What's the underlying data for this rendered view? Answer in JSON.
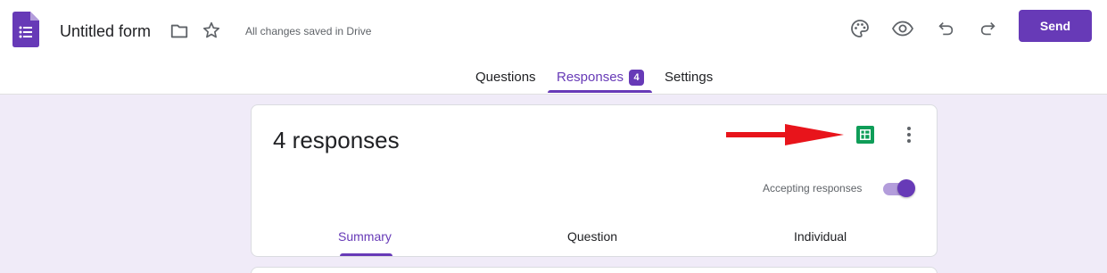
{
  "header": {
    "form_title": "Untitled form",
    "save_status": "All changes saved in Drive",
    "send_label": "Send"
  },
  "tabs": [
    {
      "label": "Questions"
    },
    {
      "label": "Responses",
      "badge": "4",
      "active": true
    },
    {
      "label": "Settings"
    }
  ],
  "responses_card": {
    "count_text": "4 responses",
    "accepting_label": "Accepting responses",
    "accepting_enabled": true,
    "subtabs": [
      {
        "label": "Summary",
        "active": true
      },
      {
        "label": "Question"
      },
      {
        "label": "Individual"
      }
    ]
  },
  "icons": {
    "logo": "google-forms-icon",
    "folder": "folder-icon",
    "star": "star-icon",
    "palette": "palette-icon",
    "preview": "eye-icon",
    "undo": "undo-icon",
    "redo": "redo-icon",
    "sheets": "sheets-icon",
    "more": "more-vert-icon",
    "annotation": "red-arrow"
  },
  "colors": {
    "accent": "#673ab7",
    "background": "#f0ebf8",
    "sheets_green": "#0f9d58",
    "arrow_red": "#e8141b"
  }
}
